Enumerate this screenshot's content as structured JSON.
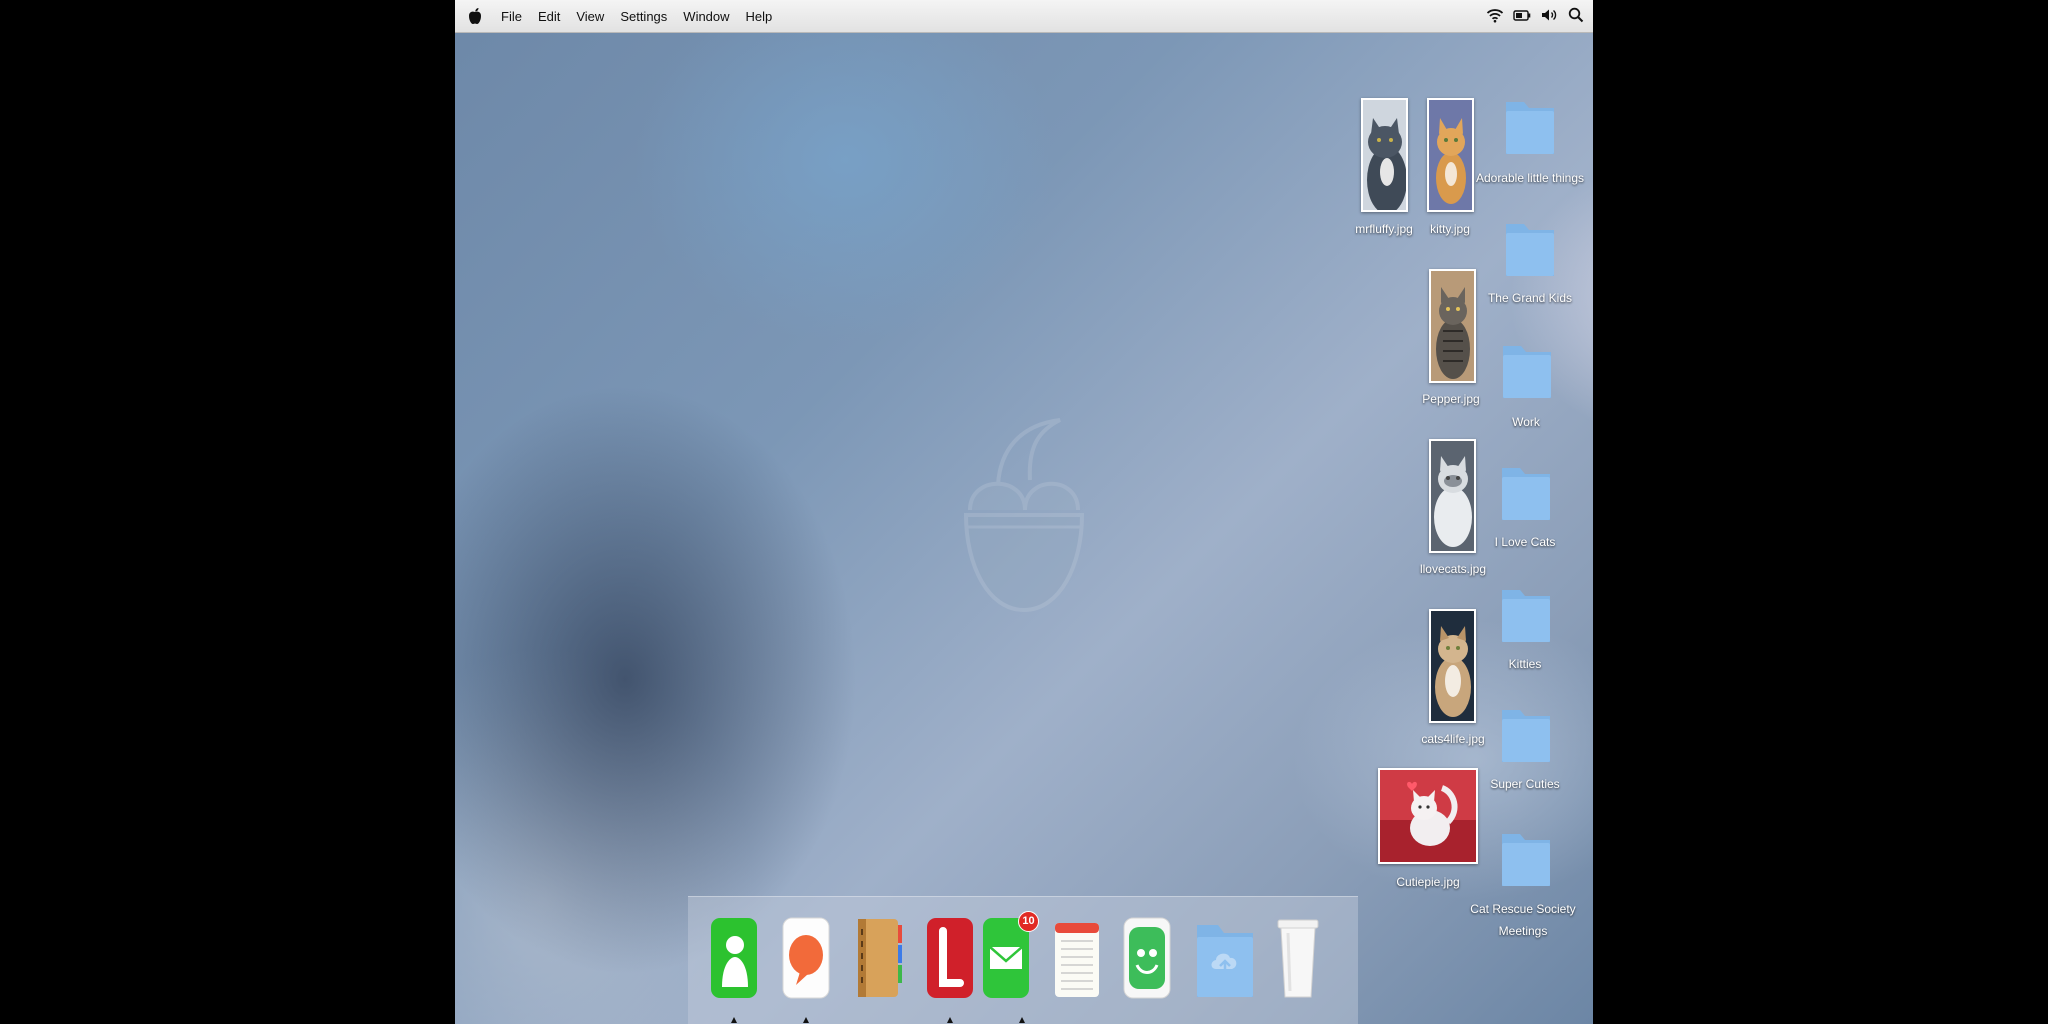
{
  "menubar": {
    "items": [
      "File",
      "Edit",
      "View",
      "Settings",
      "Window",
      "Help"
    ]
  },
  "desktop": {
    "images": [
      {
        "name": "mrfluffy.jpg"
      },
      {
        "name": "kitty.jpg"
      },
      {
        "name": "Pepper.jpg"
      },
      {
        "name": "llovecats.jpg"
      },
      {
        "name": "cats4life.jpg"
      },
      {
        "name": "Cutiepie.jpg"
      }
    ],
    "folders": [
      {
        "name": "Adorable little things"
      },
      {
        "name": "The Grand Kids"
      },
      {
        "name": "Work"
      },
      {
        "name": "I Love Cats"
      },
      {
        "name": "Kitties"
      },
      {
        "name": "Super Cuties"
      },
      {
        "name": "Cat Rescue Society Meetings",
        "line1": "Cat Rescue Society",
        "line2": "Meetings"
      }
    ]
  },
  "dock": {
    "apps": [
      "contacts-icon",
      "messages-icon",
      "address-book-icon",
      "l-app-icon",
      "mail-icon",
      "notes-icon",
      "face-app-icon",
      "downloads-folder-icon",
      "trash-icon"
    ],
    "mail_badge": "10"
  },
  "colors": {
    "folder_blue": "#8ec0ef",
    "mail_green": "#2fc53a",
    "badge_red": "#e12a24"
  }
}
